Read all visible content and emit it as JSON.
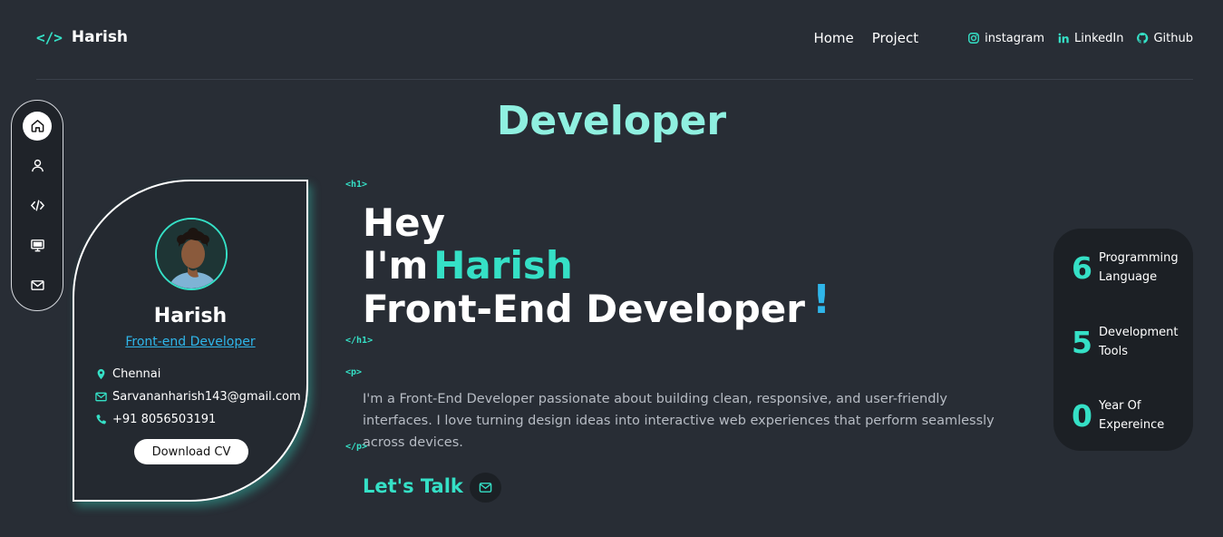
{
  "brand": {
    "logo_icon": "</>",
    "name": "Harish"
  },
  "nav": {
    "home": "Home",
    "project": "Project"
  },
  "social": {
    "instagram": "instagram",
    "linkedin": "LinkedIn",
    "github": "Github"
  },
  "side_nav": [
    {
      "icon": "home-icon",
      "active": true
    },
    {
      "icon": "user-icon",
      "active": false
    },
    {
      "icon": "code-icon",
      "active": false
    },
    {
      "icon": "monitor-icon",
      "active": false
    },
    {
      "icon": "mail-icon",
      "active": false
    }
  ],
  "hero": {
    "title": "Developer",
    "h1_open": "<h1>",
    "h1_close": "</h1>",
    "line1": "Hey",
    "line2_prefix": "I'm",
    "line2_name": "Harish",
    "line3": "Front-End Developer",
    "exclaim": "!",
    "p_open": "<p>",
    "p_close": "</p>",
    "paragraph": "I'm a Front-End Developer passionate about building clean, responsive, and user-friendly interfaces. I love turning design ideas into interactive web experiences that perform seamlessly across devices.",
    "lets_talk": "Let's Talk"
  },
  "profile": {
    "name": "Harish",
    "role": "Front-end Developer",
    "location": "Chennai",
    "email": "Sarvananharish143@gmail.com",
    "phone": "+91 8056503191",
    "download_label": "Download CV"
  },
  "stats": [
    {
      "value": "6",
      "label_line1": "Programming",
      "label_line2": "Language"
    },
    {
      "value": "5",
      "label_line1": "Development",
      "label_line2": "Tools"
    },
    {
      "value": "0",
      "label_line1": "Year Of",
      "label_line2": "Expereince"
    }
  ],
  "colors": {
    "accent": "#35e0c6",
    "background": "#282d35",
    "link": "#2fb6ea",
    "title": "#8ff0e0"
  }
}
